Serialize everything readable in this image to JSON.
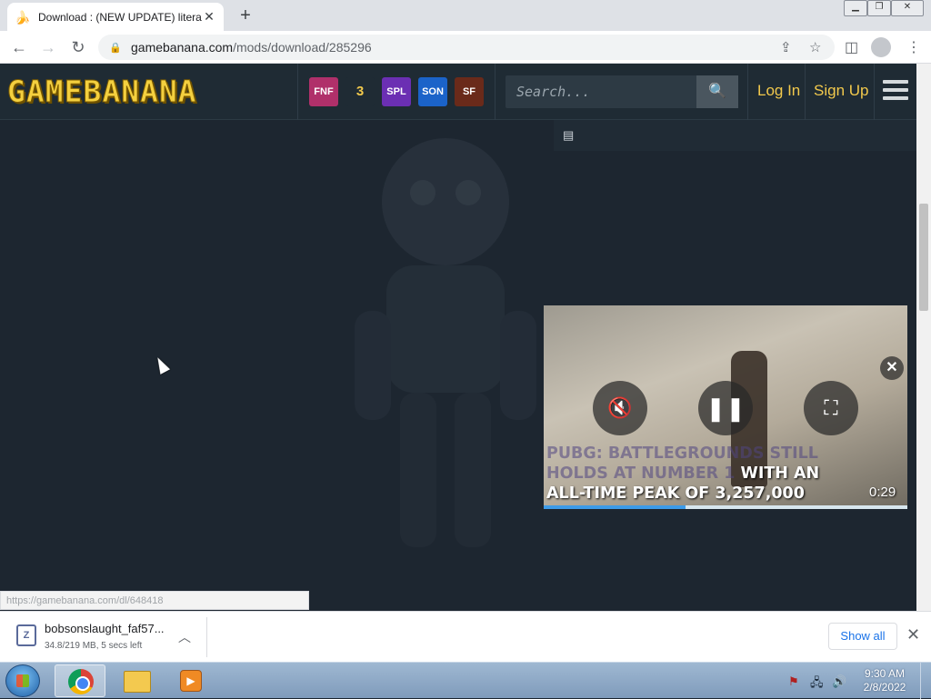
{
  "browser": {
    "tab": {
      "title": "Download : (NEW UPDATE) litera",
      "favicon": "banana-icon"
    },
    "new_tab_label": "+",
    "url": {
      "host": "gamebanana.com",
      "path": "/mods/download/285296"
    }
  },
  "site": {
    "logo": "GAMEBANANA",
    "game_icons": [
      {
        "name": "fnf-icon",
        "label": "FNF",
        "color": "#b0306a"
      },
      {
        "name": "3air-icon",
        "label": "3 A.I.R.",
        "color": "#1f2b34"
      },
      {
        "name": "splatoon-icon",
        "label": "SPL",
        "color": "#6b2fb3"
      },
      {
        "name": "sonic-icon",
        "label": "SON",
        "color": "#1b63c9"
      },
      {
        "name": "sf-icon",
        "label": "SF",
        "color": "#6a2a1a"
      }
    ],
    "search_placeholder": "Search...",
    "login": "Log In",
    "signup": "Sign Up"
  },
  "video": {
    "caption_faded": "PUBG: BATTLEGROUNDS STILL HOLDS AT NUMBER 1",
    "caption_main_1": "WITH AN",
    "caption_main_2": "ALL-TIME PEAK OF 3,257,000",
    "time": "0:29",
    "progress": 0.39
  },
  "status_url": "https://gamebanana.com/dl/648418",
  "download": {
    "filename": "bobsonslaught_faf57...",
    "progress_text": "34.8/219 MB, 5 secs left",
    "show_all": "Show all"
  },
  "taskbar": {
    "time": "9:30 AM",
    "date": "2/8/2022"
  },
  "colors": {
    "accent": "#f2c94c",
    "page_bg": "#1d2630",
    "header_bg": "#1f2b34"
  }
}
